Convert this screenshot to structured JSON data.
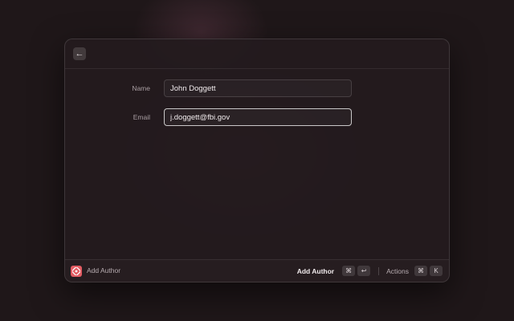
{
  "topbar": {
    "back_icon": "arrow-left-icon",
    "back_glyph": "←"
  },
  "form": {
    "name_label": "Name",
    "name_value": "John Doggett",
    "email_label": "Email",
    "email_value": "j.doggett@fbi.gov"
  },
  "bottombar": {
    "extension_icon": "extension-icon",
    "extension_name": "Add Author",
    "primary_action": "Add Author",
    "primary_keys": [
      "⌘",
      "↩"
    ],
    "actions_label": "Actions",
    "actions_keys": [
      "⌘",
      "K"
    ]
  },
  "colors": {
    "accent_icon": "#e25c63",
    "background": "#1f1719",
    "window": "#231b1e"
  }
}
